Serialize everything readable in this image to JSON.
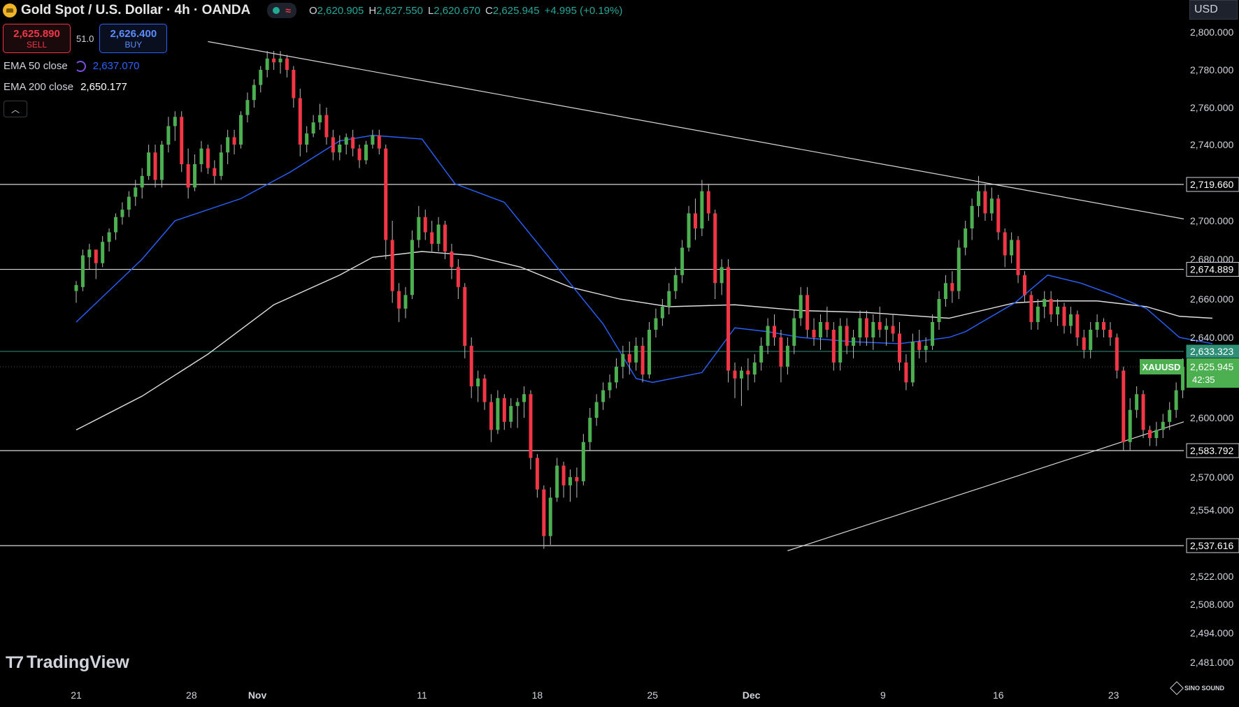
{
  "header": {
    "title": "Gold Spot / U.S. Dollar · 4h · OANDA",
    "ohlc": [
      {
        "k": "O",
        "v": "2,620.905"
      },
      {
        "k": "H",
        "v": "2,627.550"
      },
      {
        "k": "L",
        "v": "2,620.670"
      },
      {
        "k": "C",
        "v": "2,625.945"
      },
      {
        "k": "",
        "v": "+4.995 (+0.19%)"
      }
    ]
  },
  "trade": {
    "sell_price": "2,625.890",
    "sell_label": "SELL",
    "spread": "51.0",
    "buy_price": "2,626.400",
    "buy_label": "BUY"
  },
  "indicators": {
    "ema50_label": "EMA 50 close",
    "ema50_value": "2,637.070",
    "ema200_label": "EMA 200 close",
    "ema200_value": "2,650.177"
  },
  "axis": {
    "currency": "USD"
  },
  "branding": {
    "logo_text": "TradingView",
    "watermark": "SINO SOUND"
  },
  "colors": {
    "up": "#26a69a",
    "up_candle": "#4caf50",
    "down": "#f23645",
    "ema50": "#2962ff",
    "ema200": "#e0e0e0",
    "level_line": "#d8d8d8",
    "current_line": "#26a69a",
    "bid_line": "#2f8f76"
  },
  "chart_data": {
    "type": "candlestick",
    "symbol": "XAUUSD",
    "timeframe": "4h",
    "x_ticks": [
      "21",
      "28",
      "Nov",
      "11",
      "18",
      "25",
      "Dec",
      "9",
      "16",
      "23"
    ],
    "y_ticks": [
      {
        "v": 2800,
        "l": "2,800.000"
      },
      {
        "v": 2780,
        "l": "2,780.000"
      },
      {
        "v": 2760,
        "l": "2,760.000"
      },
      {
        "v": 2740,
        "l": "2,740.000"
      },
      {
        "v": 2700,
        "l": "2,700.000"
      },
      {
        "v": 2680,
        "l": "2,680.000"
      },
      {
        "v": 2660,
        "l": "2,660.000"
      },
      {
        "v": 2640,
        "l": "2,640.000"
      },
      {
        "v": 2600,
        "l": "2,600.000"
      },
      {
        "v": 2570,
        "l": "2,570.000"
      },
      {
        "v": 2554,
        "l": "2,554.000"
      },
      {
        "v": 2522,
        "l": "2,522.000"
      },
      {
        "v": 2508,
        "l": "2,508.000"
      },
      {
        "v": 2494,
        "l": "2,494.000"
      },
      {
        "v": 2481,
        "l": "2,481.000"
      }
    ],
    "levels": [
      {
        "v": 2719.66,
        "label": "2,719.660"
      },
      {
        "v": 2674.889,
        "label": "2,674.889"
      },
      {
        "v": 2583.792,
        "label": "2,583.792"
      },
      {
        "v": 2537.616,
        "label": "2,537.616"
      }
    ],
    "bid_level": {
      "v": 2633.323,
      "label": "2,633.323"
    },
    "current": {
      "v": 2625.945,
      "label": "2,625.945",
      "countdown": "42:35",
      "symbol": "XAUUSD"
    },
    "trendlines": [
      {
        "from": [
          8,
          2795
        ],
        "to": [
          74,
          2701
        ]
      },
      {
        "from": [
          43.2,
          2535
        ],
        "to": [
          74,
          2598
        ]
      }
    ],
    "ema50": [
      [
        0,
        2648
      ],
      [
        4,
        2680
      ],
      [
        6,
        2700
      ],
      [
        10,
        2712
      ],
      [
        13,
        2726
      ],
      [
        16,
        2742
      ],
      [
        18,
        2745
      ],
      [
        21,
        2743
      ],
      [
        23,
        2720
      ],
      [
        26,
        2710
      ],
      [
        29,
        2678
      ],
      [
        32,
        2647
      ],
      [
        34,
        2620
      ],
      [
        35,
        2618
      ],
      [
        38,
        2623
      ],
      [
        40,
        2645
      ],
      [
        42,
        2643
      ],
      [
        44,
        2640
      ],
      [
        47,
        2638
      ],
      [
        50,
        2637
      ],
      [
        53,
        2640
      ],
      [
        54,
        2643
      ],
      [
        57,
        2658
      ],
      [
        59,
        2672
      ],
      [
        61,
        2668
      ],
      [
        63,
        2662
      ],
      [
        65,
        2655
      ],
      [
        67,
        2640
      ],
      [
        69,
        2637
      ]
    ],
    "ema200": [
      [
        0,
        2594
      ],
      [
        4,
        2611
      ],
      [
        8,
        2632
      ],
      [
        12,
        2657
      ],
      [
        16,
        2672
      ],
      [
        18,
        2681
      ],
      [
        21,
        2684
      ],
      [
        24,
        2682
      ],
      [
        27,
        2676
      ],
      [
        30,
        2666
      ],
      [
        33,
        2660
      ],
      [
        36,
        2656
      ],
      [
        40,
        2657
      ],
      [
        44,
        2654
      ],
      [
        48,
        2653
      ],
      [
        53,
        2650
      ],
      [
        57,
        2658
      ],
      [
        59,
        2659
      ],
      [
        62,
        2659
      ],
      [
        65,
        2656
      ],
      [
        67,
        2651
      ],
      [
        69,
        2650
      ]
    ],
    "candles": [
      [
        0,
        2664,
        2669,
        2658,
        2667
      ],
      [
        0.4,
        2666,
        2685,
        2664,
        2682
      ],
      [
        0.8,
        2681,
        2688,
        2675,
        2685
      ],
      [
        1.2,
        2685,
        2683,
        2670,
        2678
      ],
      [
        1.6,
        2678,
        2692,
        2676,
        2689
      ],
      [
        2,
        2689,
        2696,
        2684,
        2694
      ],
      [
        2.4,
        2694,
        2704,
        2690,
        2702
      ],
      [
        2.8,
        2702,
        2710,
        2698,
        2706
      ],
      [
        3.2,
        2706,
        2716,
        2702,
        2713
      ],
      [
        3.6,
        2713,
        2722,
        2708,
        2718
      ],
      [
        4,
        2718,
        2728,
        2712,
        2724
      ],
      [
        4.4,
        2724,
        2740,
        2722,
        2736
      ],
      [
        4.8,
        2736,
        2740,
        2718,
        2722
      ],
      [
        5.2,
        2722,
        2742,
        2718,
        2740
      ],
      [
        5.6,
        2740,
        2755,
        2736,
        2750
      ],
      [
        6,
        2750,
        2758,
        2742,
        2755
      ],
      [
        6.4,
        2755,
        2758,
        2726,
        2730
      ],
      [
        6.8,
        2730,
        2738,
        2712,
        2718
      ],
      [
        7.2,
        2718,
        2735,
        2716,
        2730
      ],
      [
        7.6,
        2730,
        2742,
        2726,
        2738
      ],
      [
        8,
        2738,
        2740,
        2725,
        2728
      ],
      [
        8.4,
        2728,
        2732,
        2720,
        2724
      ],
      [
        8.8,
        2724,
        2740,
        2722,
        2736
      ],
      [
        9.2,
        2736,
        2748,
        2730,
        2744
      ],
      [
        9.6,
        2744,
        2748,
        2735,
        2740
      ],
      [
        10,
        2740,
        2758,
        2738,
        2756
      ],
      [
        10.4,
        2756,
        2768,
        2752,
        2764
      ],
      [
        10.8,
        2764,
        2775,
        2760,
        2772
      ],
      [
        11.2,
        2772,
        2782,
        2768,
        2780
      ],
      [
        11.6,
        2780,
        2790,
        2776,
        2786
      ],
      [
        12,
        2786,
        2790,
        2780,
        2784
      ],
      [
        12.4,
        2784,
        2790,
        2778,
        2786
      ],
      [
        12.8,
        2786,
        2788,
        2776,
        2780
      ],
      [
        13.2,
        2780,
        2782,
        2760,
        2765
      ],
      [
        13.6,
        2765,
        2770,
        2734,
        2740
      ],
      [
        14,
        2740,
        2750,
        2736,
        2746
      ],
      [
        14.4,
        2746,
        2756,
        2744,
        2752
      ],
      [
        14.8,
        2752,
        2762,
        2748,
        2756
      ],
      [
        15.2,
        2756,
        2760,
        2740,
        2744
      ],
      [
        15.6,
        2744,
        2748,
        2732,
        2736
      ],
      [
        16,
        2736,
        2745,
        2732,
        2740
      ],
      [
        16.4,
        2740,
        2746,
        2735,
        2744
      ],
      [
        16.8,
        2744,
        2748,
        2734,
        2738
      ],
      [
        17.2,
        2738,
        2740,
        2728,
        2732
      ],
      [
        17.6,
        2732,
        2742,
        2730,
        2740
      ],
      [
        18,
        2740,
        2748,
        2738,
        2745
      ],
      [
        18.4,
        2745,
        2748,
        2735,
        2738
      ],
      [
        18.8,
        2738,
        2740,
        2680,
        2690
      ],
      [
        19.2,
        2690,
        2700,
        2658,
        2664
      ],
      [
        19.6,
        2664,
        2668,
        2648,
        2655
      ],
      [
        20,
        2655,
        2666,
        2650,
        2662
      ],
      [
        20.4,
        2662,
        2695,
        2660,
        2690
      ],
      [
        20.8,
        2690,
        2708,
        2686,
        2702
      ],
      [
        21.2,
        2702,
        2706,
        2690,
        2694
      ],
      [
        21.6,
        2694,
        2700,
        2684,
        2688
      ],
      [
        22,
        2688,
        2702,
        2684,
        2698
      ],
      [
        22.4,
        2698,
        2700,
        2680,
        2684
      ],
      [
        22.8,
        2684,
        2688,
        2670,
        2676
      ],
      [
        23.2,
        2676,
        2680,
        2660,
        2666
      ],
      [
        23.6,
        2666,
        2668,
        2630,
        2636
      ],
      [
        24,
        2636,
        2640,
        2610,
        2616
      ],
      [
        24.4,
        2616,
        2624,
        2608,
        2620
      ],
      [
        24.8,
        2620,
        2622,
        2604,
        2608
      ],
      [
        25.2,
        2608,
        2612,
        2588,
        2594
      ],
      [
        25.6,
        2594,
        2614,
        2592,
        2610
      ],
      [
        26,
        2610,
        2612,
        2594,
        2598
      ],
      [
        26.4,
        2598,
        2610,
        2595,
        2606
      ],
      [
        26.8,
        2606,
        2610,
        2595,
        2608
      ],
      [
        27.2,
        2608,
        2616,
        2600,
        2612
      ],
      [
        27.6,
        2612,
        2614,
        2574,
        2580
      ],
      [
        28,
        2580,
        2582,
        2560,
        2564
      ],
      [
        28.4,
        2564,
        2566,
        2536,
        2542
      ],
      [
        28.8,
        2542,
        2565,
        2538,
        2560
      ],
      [
        29.2,
        2560,
        2580,
        2558,
        2576
      ],
      [
        29.6,
        2576,
        2578,
        2560,
        2566
      ],
      [
        30,
        2566,
        2574,
        2558,
        2570
      ],
      [
        30.4,
        2570,
        2575,
        2560,
        2568
      ],
      [
        30.8,
        2568,
        2592,
        2566,
        2588
      ],
      [
        31.2,
        2588,
        2605,
        2584,
        2600
      ],
      [
        31.6,
        2600,
        2612,
        2596,
        2608
      ],
      [
        32,
        2608,
        2618,
        2604,
        2614
      ],
      [
        32.4,
        2614,
        2622,
        2610,
        2618
      ],
      [
        32.8,
        2618,
        2630,
        2615,
        2626
      ],
      [
        33.2,
        2626,
        2636,
        2620,
        2632
      ],
      [
        33.6,
        2632,
        2638,
        2622,
        2628
      ],
      [
        34,
        2628,
        2640,
        2624,
        2636
      ],
      [
        34.4,
        2636,
        2640,
        2618,
        2622
      ],
      [
        34.8,
        2622,
        2648,
        2620,
        2644
      ],
      [
        35.2,
        2644,
        2655,
        2640,
        2650
      ],
      [
        35.6,
        2650,
        2660,
        2646,
        2656
      ],
      [
        36,
        2656,
        2668,
        2652,
        2664
      ],
      [
        36.4,
        2664,
        2676,
        2660,
        2672
      ],
      [
        36.8,
        2672,
        2690,
        2668,
        2686
      ],
      [
        37.2,
        2686,
        2708,
        2684,
        2704
      ],
      [
        37.6,
        2704,
        2712,
        2690,
        2696
      ],
      [
        38,
        2696,
        2722,
        2692,
        2716
      ],
      [
        38.4,
        2716,
        2720,
        2700,
        2704
      ],
      [
        38.8,
        2704,
        2706,
        2660,
        2668
      ],
      [
        39.2,
        2668,
        2680,
        2662,
        2676
      ],
      [
        39.6,
        2676,
        2680,
        2618,
        2624
      ],
      [
        40,
        2624,
        2628,
        2610,
        2620
      ],
      [
        40.4,
        2620,
        2626,
        2606,
        2624
      ],
      [
        40.8,
        2624,
        2630,
        2614,
        2622
      ],
      [
        41.2,
        2622,
        2632,
        2618,
        2628
      ],
      [
        41.6,
        2628,
        2640,
        2624,
        2636
      ],
      [
        42,
        2636,
        2650,
        2632,
        2646
      ],
      [
        42.4,
        2646,
        2652,
        2636,
        2640
      ],
      [
        42.8,
        2640,
        2644,
        2618,
        2626
      ],
      [
        43.2,
        2626,
        2640,
        2622,
        2636
      ],
      [
        43.6,
        2636,
        2654,
        2632,
        2650
      ],
      [
        44,
        2650,
        2666,
        2646,
        2662
      ],
      [
        44.4,
        2662,
        2666,
        2640,
        2644
      ],
      [
        44.8,
        2644,
        2650,
        2636,
        2640
      ],
      [
        45.2,
        2640,
        2652,
        2634,
        2648
      ],
      [
        45.6,
        2648,
        2656,
        2640,
        2644
      ],
      [
        46,
        2644,
        2648,
        2624,
        2628
      ],
      [
        46.4,
        2628,
        2650,
        2624,
        2646
      ],
      [
        46.8,
        2646,
        2650,
        2632,
        2636
      ],
      [
        47.2,
        2636,
        2644,
        2630,
        2640
      ],
      [
        47.6,
        2640,
        2654,
        2636,
        2650
      ],
      [
        48,
        2650,
        2654,
        2636,
        2640
      ],
      [
        48.4,
        2640,
        2652,
        2634,
        2648
      ],
      [
        48.8,
        2648,
        2656,
        2640,
        2644
      ],
      [
        49.2,
        2644,
        2650,
        2636,
        2646
      ],
      [
        49.6,
        2646,
        2652,
        2638,
        2642
      ],
      [
        50,
        2642,
        2648,
        2624,
        2628
      ],
      [
        50.4,
        2628,
        2632,
        2614,
        2618
      ],
      [
        50.8,
        2618,
        2642,
        2616,
        2638
      ],
      [
        51.2,
        2638,
        2644,
        2630,
        2634
      ],
      [
        51.6,
        2634,
        2640,
        2628,
        2636
      ],
      [
        52,
        2636,
        2652,
        2634,
        2648
      ],
      [
        52.4,
        2648,
        2664,
        2644,
        2660
      ],
      [
        52.8,
        2660,
        2672,
        2656,
        2668
      ],
      [
        53.2,
        2668,
        2674,
        2658,
        2664
      ],
      [
        53.6,
        2664,
        2690,
        2660,
        2686
      ],
      [
        54,
        2686,
        2700,
        2682,
        2696
      ],
      [
        54.4,
        2696,
        2712,
        2690,
        2708
      ],
      [
        54.8,
        2708,
        2724,
        2702,
        2716
      ],
      [
        55.2,
        2716,
        2720,
        2700,
        2704
      ],
      [
        55.6,
        2704,
        2718,
        2700,
        2712
      ],
      [
        56,
        2712,
        2714,
        2690,
        2694
      ],
      [
        56.4,
        2694,
        2696,
        2676,
        2682
      ],
      [
        56.8,
        2682,
        2694,
        2678,
        2690
      ],
      [
        57.2,
        2690,
        2692,
        2668,
        2672
      ],
      [
        57.6,
        2672,
        2674,
        2658,
        2662
      ],
      [
        58,
        2662,
        2664,
        2644,
        2648
      ],
      [
        58.4,
        2648,
        2660,
        2644,
        2656
      ],
      [
        58.8,
        2656,
        2664,
        2650,
        2660
      ],
      [
        59.2,
        2660,
        2664,
        2648,
        2652
      ],
      [
        59.6,
        2652,
        2660,
        2646,
        2656
      ],
      [
        60,
        2656,
        2658,
        2642,
        2646
      ],
      [
        60.4,
        2646,
        2656,
        2642,
        2652
      ],
      [
        60.8,
        2652,
        2654,
        2636,
        2640
      ],
      [
        61.2,
        2640,
        2644,
        2630,
        2634
      ],
      [
        61.6,
        2634,
        2648,
        2630,
        2644
      ],
      [
        62,
        2644,
        2652,
        2640,
        2648
      ],
      [
        62.4,
        2648,
        2650,
        2640,
        2644
      ],
      [
        62.8,
        2644,
        2648,
        2636,
        2640
      ],
      [
        63.2,
        2640,
        2642,
        2620,
        2624
      ],
      [
        63.6,
        2624,
        2626,
        2584,
        2588
      ],
      [
        64,
        2588,
        2610,
        2584,
        2604
      ],
      [
        64.4,
        2604,
        2616,
        2600,
        2612
      ],
      [
        64.8,
        2612,
        2614,
        2590,
        2594
      ],
      [
        65.2,
        2594,
        2596,
        2586,
        2590
      ],
      [
        65.6,
        2590,
        2598,
        2586,
        2594
      ],
      [
        66,
        2594,
        2602,
        2590,
        2598
      ],
      [
        66.4,
        2598,
        2608,
        2594,
        2604
      ],
      [
        66.8,
        2604,
        2618,
        2600,
        2614
      ],
      [
        67.2,
        2614,
        2630,
        2610,
        2626
      ],
      [
        67.6,
        2626,
        2628,
        2618,
        2622
      ],
      [
        68,
        2622,
        2628,
        2618,
        2626
      ]
    ]
  }
}
